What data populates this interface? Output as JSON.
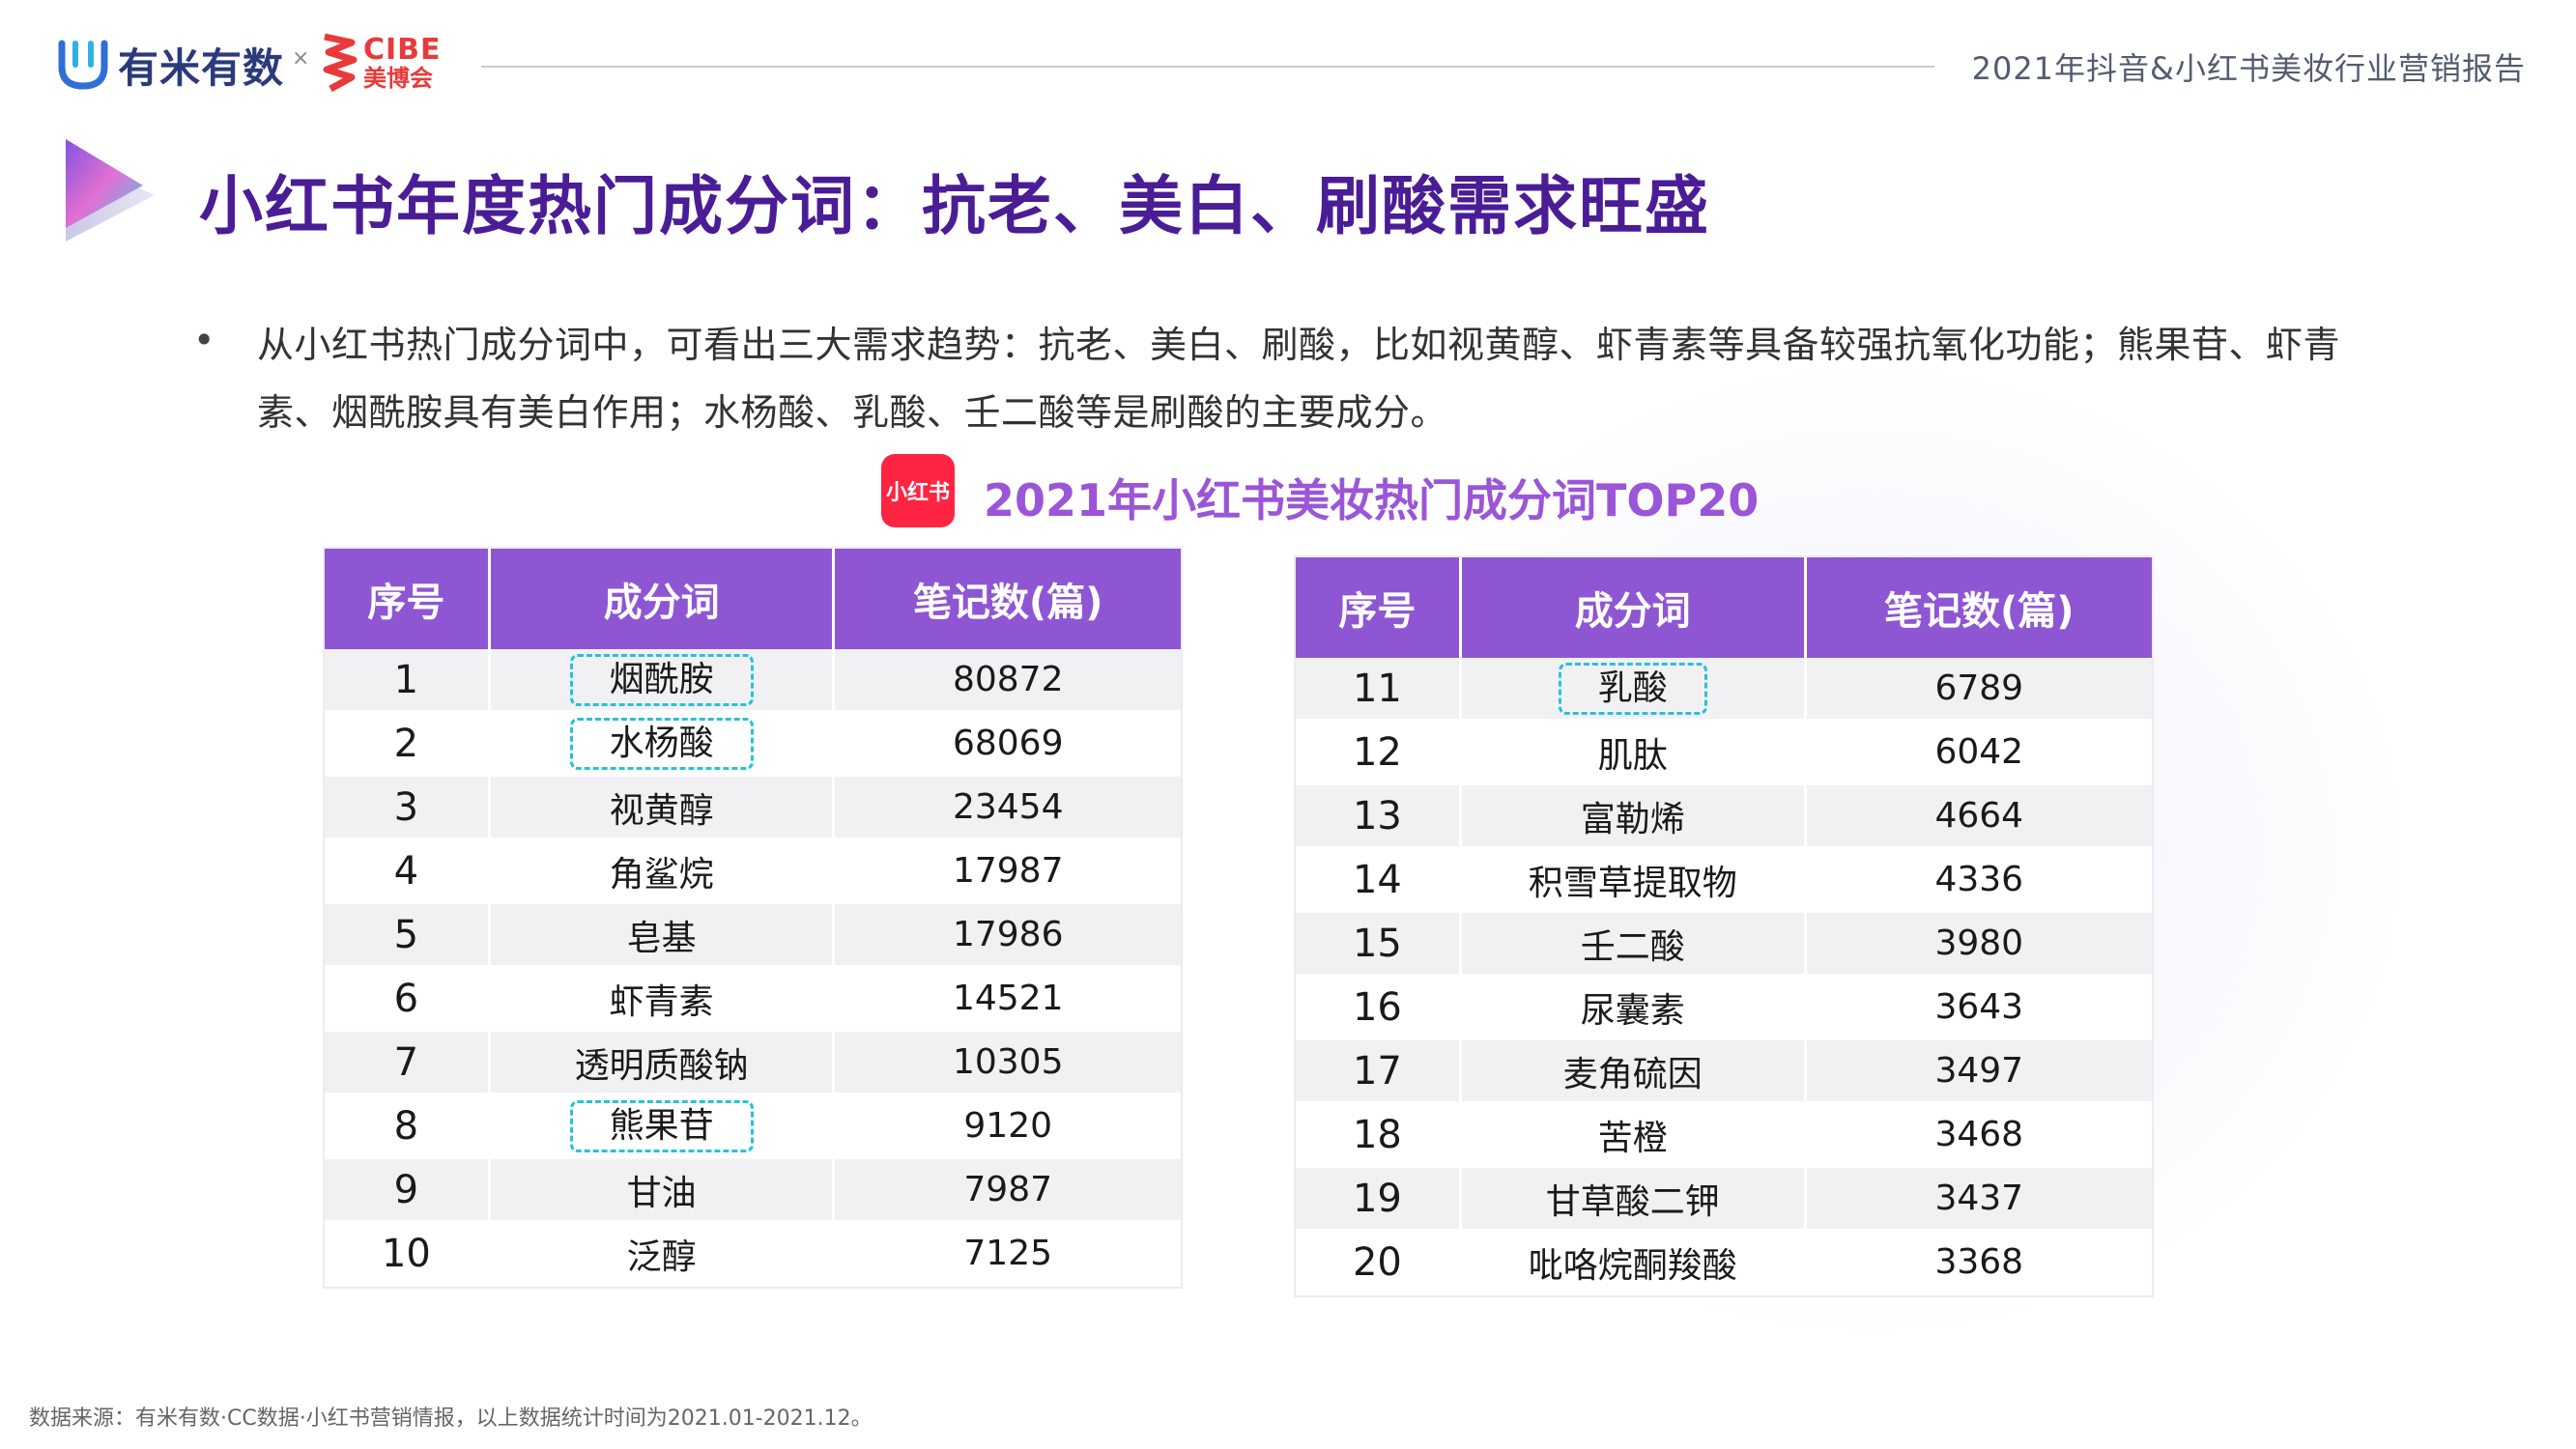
{
  "header": {
    "brand1": "有米有数",
    "separator": "×",
    "brand2_en": "CIBE",
    "brand2_cn": "美博会",
    "report_title": "2021年抖音&小红书美妆行业营销报告"
  },
  "page_title": "小红书年度热门成分词：抗老、美白、刷酸需求旺盛",
  "bullet_symbol": "•",
  "description": "从小红书热门成分词中，可看出三大需求趋势：抗老、美白、刷酸，比如视黄醇、虾青素等具备较强抗氧化功能；熊果苷、虾青素、烟酰胺具有美白作用；水杨酸、乳酸、壬二酸等是刷酸的主要成分。",
  "section": {
    "badge": "小红书",
    "title": "2021年小红书美妆热门成分词TOP20"
  },
  "columns": [
    "序号",
    "成分词",
    "笔记数(篇)"
  ],
  "colors": {
    "header_purple": "#8e56d3",
    "title_purple": "#4a1d96",
    "highlight_border": "#27c2d8",
    "xhs_red": "#ff2442"
  },
  "table_left": [
    {
      "rank": "1",
      "term": "烟酰胺",
      "notes": "80872",
      "highlight": true
    },
    {
      "rank": "2",
      "term": "水杨酸",
      "notes": "68069",
      "highlight": true
    },
    {
      "rank": "3",
      "term": "视黄醇",
      "notes": "23454",
      "highlight": false
    },
    {
      "rank": "4",
      "term": "角鲨烷",
      "notes": "17987",
      "highlight": false
    },
    {
      "rank": "5",
      "term": "皂基",
      "notes": "17986",
      "highlight": false
    },
    {
      "rank": "6",
      "term": "虾青素",
      "notes": "14521",
      "highlight": false
    },
    {
      "rank": "7",
      "term": "透明质酸钠",
      "notes": "10305",
      "highlight": false
    },
    {
      "rank": "8",
      "term": "熊果苷",
      "notes": "9120",
      "highlight": true
    },
    {
      "rank": "9",
      "term": "甘油",
      "notes": "7987",
      "highlight": false
    },
    {
      "rank": "10",
      "term": "泛醇",
      "notes": "7125",
      "highlight": false
    }
  ],
  "table_right": [
    {
      "rank": "11",
      "term": "乳酸",
      "notes": "6789",
      "highlight": true
    },
    {
      "rank": "12",
      "term": "肌肽",
      "notes": "6042",
      "highlight": false
    },
    {
      "rank": "13",
      "term": "富勒烯",
      "notes": "4664",
      "highlight": false
    },
    {
      "rank": "14",
      "term": "积雪草提取物",
      "notes": "4336",
      "highlight": false
    },
    {
      "rank": "15",
      "term": "壬二酸",
      "notes": "3980",
      "highlight": false
    },
    {
      "rank": "16",
      "term": "尿囊素",
      "notes": "3643",
      "highlight": false
    },
    {
      "rank": "17",
      "term": "麦角硫因",
      "notes": "3497",
      "highlight": false
    },
    {
      "rank": "18",
      "term": "苦橙",
      "notes": "3468",
      "highlight": false
    },
    {
      "rank": "19",
      "term": "甘草酸二钾",
      "notes": "3437",
      "highlight": false
    },
    {
      "rank": "20",
      "term": "吡咯烷酮羧酸",
      "notes": "3368",
      "highlight": false
    }
  ],
  "footer_source": "数据来源：有米有数·CC数据·小红书营销情报，以上数据统计时间为2021.01-2021.12。"
}
